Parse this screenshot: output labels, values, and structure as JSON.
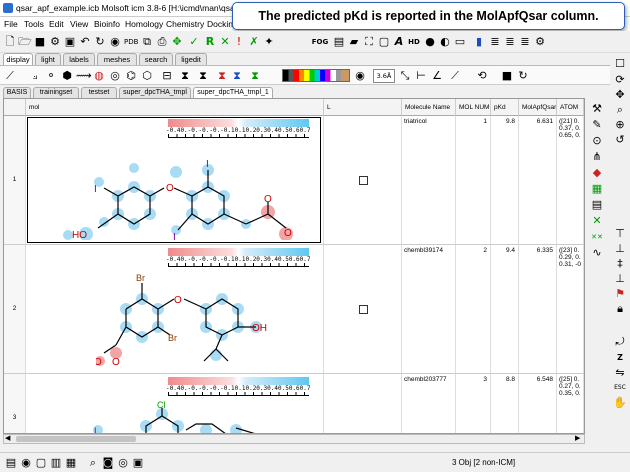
{
  "window": {
    "title": "qsar_apf_example.icb Molsoft icm 3.8-6  [H:\\icmd\\man\\qsar_"
  },
  "menu": [
    "File",
    "Tools",
    "Edit",
    "View",
    "Bioinfo",
    "Homology",
    "Chemistry",
    "Docking"
  ],
  "callout": "The predicted pKd is reported in the MolApfQsar column.",
  "toolbar_tabs": [
    "display",
    "light",
    "labels",
    "meshes",
    "search",
    "ligedit"
  ],
  "toolbar_icons": {
    "fog": "FOG",
    "zoom": "3.6Å"
  },
  "table_tabs": [
    "BASIS",
    "trainingset",
    "testset",
    "super_dpcTHA_tmpl",
    "super_dpcTHA_tmpl_1"
  ],
  "columns": {
    "mol": "mol",
    "L": "L",
    "name": "Molecule Name",
    "num": "MOL NUM",
    "pkd": "pKd",
    "apf": "MolApfQsar",
    "atom": "ATOM"
  },
  "scale_label": "-0.40.-0.-0.-0.-0.10.10.20.30.40.50.60.7",
  "rows": [
    {
      "index": "1",
      "name": "triatricol",
      "num": "1",
      "pkd": "9.8",
      "apf": "6.631",
      "atom": [
        "([21] 0.",
        "0.37, 0.",
        "0.65, 0."
      ]
    },
    {
      "index": "2",
      "name": "chembl39174",
      "num": "2",
      "pkd": "9.4",
      "apf": "6.335",
      "atom": [
        "([23] 0.",
        "0.29, 0.",
        "0.31, -0"
      ]
    },
    {
      "index": "3",
      "name": "chembl203777",
      "num": "3",
      "pkd": "8.8",
      "apf": "6.548",
      "atom": [
        "([25] 0.",
        "0.27, 0.",
        "0.35, 0."
      ]
    }
  ],
  "status": {
    "text": "3  Obj [2 non-ICM]"
  },
  "atoms": {
    "I": "I",
    "HO": "HO",
    "O": "O",
    "Br": "Br",
    "OH": "OH",
    "Cl": "Cl"
  }
}
